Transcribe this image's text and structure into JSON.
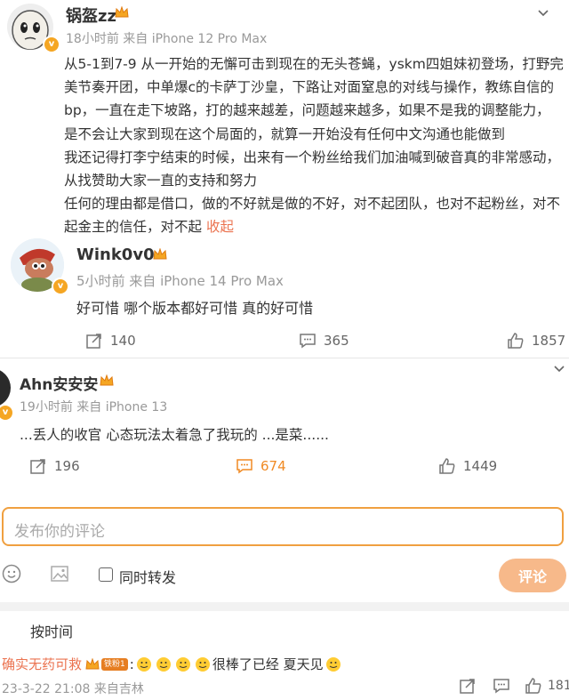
{
  "post": {
    "username": "锅盔zz",
    "meta": "18小时前  来自 iPhone 12 Pro Max",
    "lines": [
      "从5-1到7-9 从一开始的无懈可击到现在的无头苍蝇，yskm四姐妹初登场，打野完",
      "美节奏开团，中单爆c的卡萨丁沙皇，下路让对面窒息的对线与操作，教练自信的",
      "bp，一直在走下坡路，打的越来越差，问题越来越多，如果不是我的调整能力，",
      "是不会让大家到现在这个局面的，就算一开始没有任何中文沟通也能做到",
      "我还记得打李宁结束的时候，出来有一个粉丝给我们加油喊到破音真的非常感动，",
      "从找赞助大家一直的支持和努力",
      "任何的理由都是借口，做的不好就是做的不好，对不起团队，也对不起粉丝，对不",
      "起金主的信任，对不起 "
    ],
    "collapse": "收起"
  },
  "comment1": {
    "username": "Wink0v0",
    "meta": "5小时前  来自 iPhone 14 Pro Max",
    "text": "好可惜  哪个版本都好可惜 真的好可惜",
    "repost": "140",
    "comments": "365",
    "likes": "1857"
  },
  "comment2": {
    "username": "Ahn安安安",
    "meta": "19小时前  来自 iPhone 13",
    "text": "...丢人的收官  心态玩法太着急了我玩的  ...是菜......",
    "repost": "196",
    "comments": "674",
    "likes": "1449"
  },
  "composer": {
    "placeholder": "发布你的评论",
    "forward_label": "同时转发",
    "submit": "评论"
  },
  "sort": {
    "label": "按时间"
  },
  "reply": {
    "username": "确实无药可救",
    "fan_badge": "铁粉1",
    "text": "很棒了已经 夏天见",
    "meta": "23-3-22 21:08  来自吉林",
    "likes": "181"
  },
  "colors": {
    "orange": "#f08a24",
    "gray": "#999999",
    "link": "#eb7350"
  }
}
